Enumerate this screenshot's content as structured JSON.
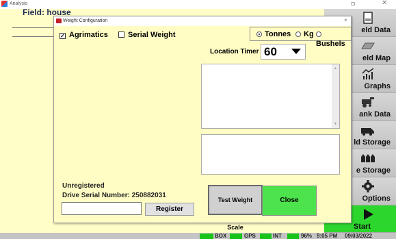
{
  "window": {
    "title": "Analysis",
    "minimize": "ㅁ",
    "close": "✕"
  },
  "field": {
    "label": "Field: house"
  },
  "sidenav": {
    "items": [
      {
        "label": "eld Data",
        "icon": "document-icon"
      },
      {
        "label": "eld Map",
        "icon": "map-icon"
      },
      {
        "label": "Graphs",
        "icon": "chart-icon"
      },
      {
        "label": "ank Data",
        "icon": "combine-icon"
      },
      {
        "label": "ld Storage",
        "icon": "truck-icon"
      },
      {
        "label": "e Storage",
        "icon": "bins-icon"
      },
      {
        "label": "Options",
        "icon": "gear-icon"
      },
      {
        "label": "Start",
        "icon": "play-icon"
      }
    ]
  },
  "statusbar": {
    "box": "BOX",
    "gps": "GPS",
    "int": "INT",
    "battery": "96%",
    "time": "9:05 PM",
    "date": "09/03/2022"
  },
  "dialog": {
    "title": "Weight Configuration",
    "close": "×",
    "agrimatics": {
      "label": "Agrimatics",
      "checked": true
    },
    "serial_weight": {
      "label": "Serial Weight",
      "checked": false
    },
    "units": {
      "options": [
        "Tonnes",
        "Kg",
        "Bushels"
      ],
      "selected": "Tonnes"
    },
    "location_timer": {
      "label": "Location Timer",
      "value": "60"
    },
    "registration": {
      "status": "Unregistered",
      "serial_text": "Drive Serial Number: 250882031",
      "input_value": "",
      "register_label": "Register"
    },
    "test_label": "Test Weight Scale",
    "close_label": "Close"
  },
  "colors": {
    "background": "#fffec9",
    "dialog_background": "#fffdc4",
    "start_green": "#2dd62d",
    "close_green": "#4de34d"
  }
}
